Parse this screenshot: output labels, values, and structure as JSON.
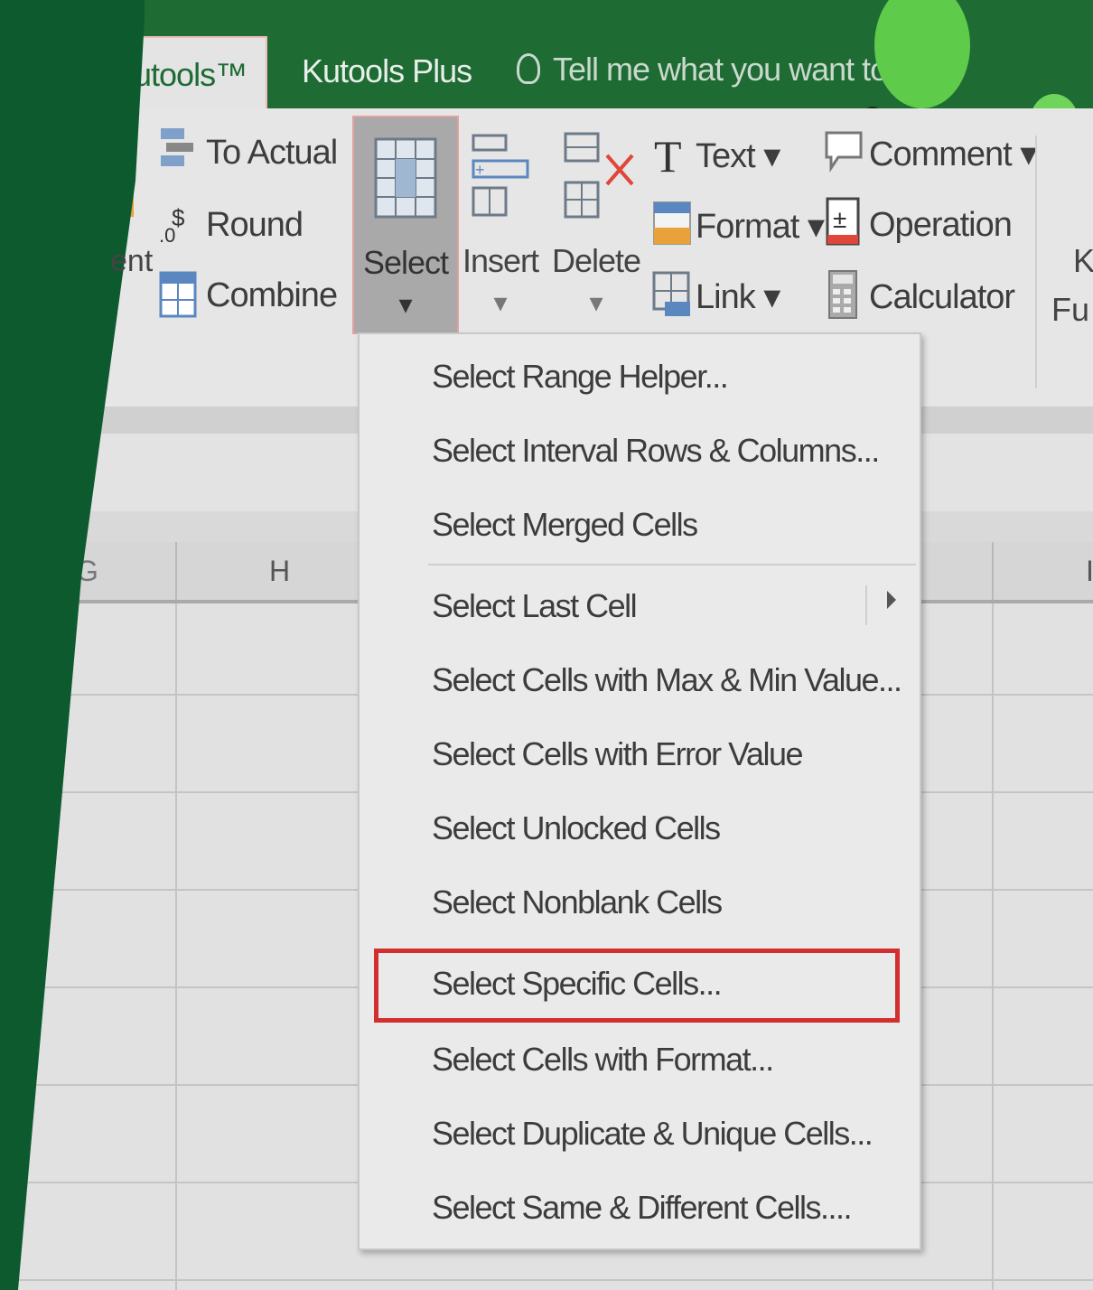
{
  "tabs": {
    "kutools_partial": "utools™",
    "kutools_plus": "Kutools Plus",
    "tell_me": "Tell me what you want to"
  },
  "ribbon": {
    "left_fragment": "ent",
    "to_actual": "To Actual",
    "round": "Round",
    "combine": "Combine",
    "select": "Select",
    "insert": "Insert",
    "delete": "Delete",
    "dropdown_arrow": "▾",
    "text": "Text ▾",
    "format": "Format ▾",
    "link": "Link ▾",
    "comment": "Comment ▾",
    "operation": "Operation",
    "calculator": "Calculator",
    "right_fragment_1": "K",
    "right_fragment_2": "Fu"
  },
  "columns": {
    "left_partial": "G",
    "h": "H",
    "right_partial": "I"
  },
  "menu": {
    "items": [
      "Select Range Helper...",
      "Select Interval Rows & Columns...",
      "Select Merged Cells",
      "Select Last Cell",
      "Select Cells with Max & Min Value...",
      "Select Cells with Error Value",
      "Select Unlocked Cells",
      "Select Nonblank Cells",
      "Select Specific Cells...",
      "Select Cells with Format...",
      "Select Duplicate & Unique Cells...",
      "Select Same & Different Cells...."
    ],
    "highlighted_index": 8,
    "submenu_item_index": 3
  },
  "colors": {
    "excel_green": "#1e6b34",
    "highlight_red": "#d32f2f",
    "blob_green": "#5ecb4b"
  }
}
